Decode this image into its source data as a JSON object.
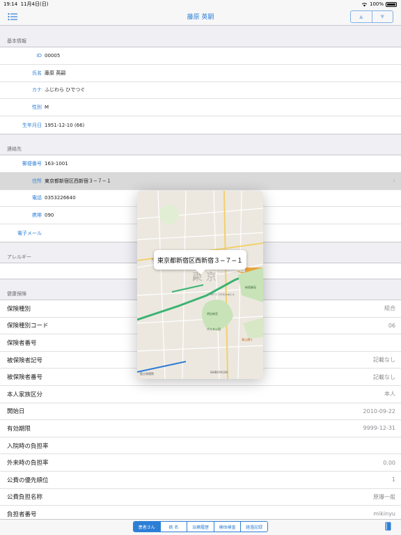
{
  "status": {
    "time": "19:14",
    "date": "11月4日(日)",
    "battery": "100%"
  },
  "nav": {
    "title": "藤原 英嗣"
  },
  "basic": {
    "header": "基本情報",
    "rows": [
      {
        "label": "ID",
        "value": "00005"
      },
      {
        "label": "氏名",
        "value": "藤原 英嗣"
      },
      {
        "label": "カナ",
        "value": "ふじわら ひでつぐ"
      },
      {
        "label": "性別",
        "value": "M"
      },
      {
        "label": "生年月日",
        "value": "1951-12-10 (66)"
      }
    ]
  },
  "contact": {
    "header": "連絡先",
    "rows": [
      {
        "label": "郵便番号",
        "value": "163-1001"
      },
      {
        "label": "住所",
        "value": "東京都新宿区西新宿３−７−１"
      },
      {
        "label": "電話",
        "value": "0353226640"
      },
      {
        "label": "携帯",
        "value": "090"
      },
      {
        "label": "電子メール",
        "value": ""
      }
    ]
  },
  "allergy": {
    "header": "アレルギー"
  },
  "insurance": {
    "header": "健康保険",
    "rows": [
      {
        "label": "保険種別",
        "value": "組合"
      },
      {
        "label": "保険種別コード",
        "value": "06"
      },
      {
        "label": "保険者番号",
        "value": ""
      },
      {
        "label": "被保険者記号",
        "value": "記載なし"
      },
      {
        "label": "被保険者番号",
        "value": "記載なし"
      },
      {
        "label": "本人家族区分",
        "value": "本人"
      },
      {
        "label": "開始日",
        "value": "2010-09-22"
      },
      {
        "label": "有効期限",
        "value": "9999-12-31"
      },
      {
        "label": "入院時の負担率",
        "value": ""
      },
      {
        "label": "外来時の負担率",
        "value": "0.00"
      },
      {
        "label": "公費の優先順位",
        "value": "1"
      },
      {
        "label": "公費負担名称",
        "value": "原爆一般"
      },
      {
        "label": "負担者番号",
        "value": "mikinyu"
      }
    ]
  },
  "map": {
    "address": "東京都新宿区西新宿３−７−１",
    "labels": {
      "big": "東 京",
      "park1": "新宿御苑",
      "shrine": "明治神宮",
      "park2": "代々木公園",
      "station": "SHIBUYA109",
      "credit": "国土地理院",
      "ntt": "NTTドコモ代々木ビル",
      "aoyama": "青山通り",
      "okubo": "大久保",
      "route": "20"
    }
  },
  "tabs": [
    "患者さん",
    "病 名",
    "治療履歴",
    "検体検査",
    "経過記録"
  ],
  "colors": {
    "accent": "#2d7fd6"
  }
}
